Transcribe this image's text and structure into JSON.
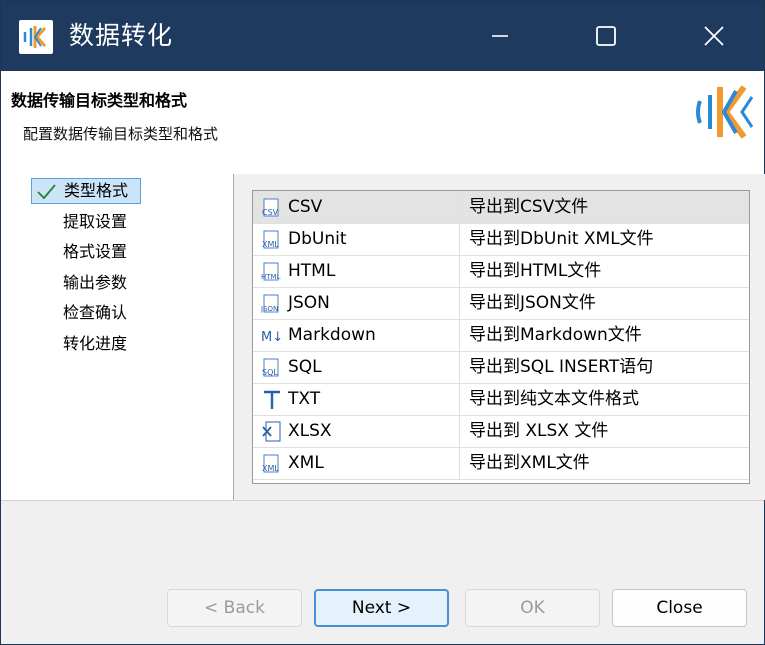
{
  "window": {
    "title": "数据转化"
  },
  "header": {
    "title": "数据传输目标类型和格式",
    "subtitle": "配置数据传输目标类型和格式"
  },
  "nav": {
    "items": [
      {
        "label": "类型格式",
        "active": true
      },
      {
        "label": "提取设置"
      },
      {
        "label": "格式设置"
      },
      {
        "label": "输出参数"
      },
      {
        "label": "检查确认"
      },
      {
        "label": "转化进度"
      }
    ]
  },
  "formats": [
    {
      "name": "CSV",
      "desc": "导出到CSV文件",
      "icon": "csv-icon",
      "selected": true
    },
    {
      "name": "DbUnit",
      "desc": "导出到DbUnit XML文件",
      "icon": "xml-icon"
    },
    {
      "name": "HTML",
      "desc": "导出到HTML文件",
      "icon": "html-icon"
    },
    {
      "name": "JSON",
      "desc": "导出到JSON文件",
      "icon": "json-icon"
    },
    {
      "name": "Markdown",
      "desc": "导出到Markdown文件",
      "icon": "markdown-icon"
    },
    {
      "name": "SQL",
      "desc": "导出到SQL INSERT语句",
      "icon": "sql-icon"
    },
    {
      "name": "TXT",
      "desc": "导出到纯文本文件格式",
      "icon": "txt-icon"
    },
    {
      "name": "XLSX",
      "desc": "导出到 XLSX 文件",
      "icon": "xlsx-icon"
    },
    {
      "name": "XML",
      "desc": "导出到XML文件",
      "icon": "xml-icon"
    }
  ],
  "buttons": {
    "back": "< Back",
    "next": "Next >",
    "ok": "OK",
    "close": "Close"
  },
  "colors": {
    "titlebar": "#1f3a5f",
    "accent": "#4a90d9",
    "logo_blue": "#2a8ad8",
    "logo_orange": "#f29a2e"
  }
}
